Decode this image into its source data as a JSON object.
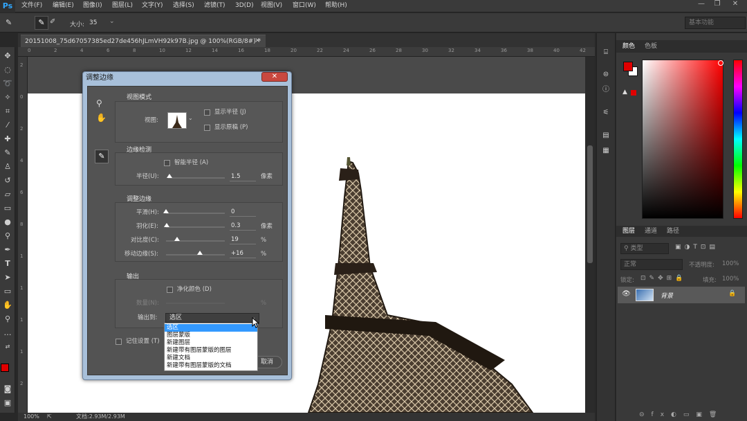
{
  "app": {
    "logo": "Ps"
  },
  "menu": [
    "文件(F)",
    "编辑(E)",
    "图像(I)",
    "图层(L)",
    "文字(Y)",
    "选择(S)",
    "滤镜(T)",
    "3D(D)",
    "视图(V)",
    "窗口(W)",
    "帮助(H)"
  ],
  "window_controls": {
    "minimize": "—",
    "restore": "❐",
    "close": "✕"
  },
  "options_bar": {
    "size_label": "大小:",
    "size_value": "35",
    "workspace": "基本功能"
  },
  "document": {
    "tab_title": "20151008_75d67057385ed27de456hJLmVH92k97B.jpg @ 100%(RGB/8#) *",
    "tab_close": "×",
    "zoom": "100%",
    "doc_info": "文档:2.93M/2.93M",
    "ruler_top_ticks": [
      "0",
      "2",
      "4",
      "6",
      "8",
      "10",
      "12",
      "14",
      "16",
      "18",
      "20",
      "22",
      "24",
      "26",
      "28",
      "30",
      "32",
      "34",
      "36",
      "38",
      "40",
      "42"
    ],
    "ruler_left_ticks": [
      "2",
      "0",
      "2",
      "4",
      "6",
      "8",
      "1",
      "1",
      "1",
      "1",
      "2"
    ]
  },
  "color_panel": {
    "tabs": [
      "颜色",
      "色板"
    ],
    "foreground": "#e00000",
    "background": "#ffffff"
  },
  "layers_panel": {
    "tabs": [
      "图层",
      "通道",
      "路径"
    ],
    "filter_placeholder": "类型",
    "blend_mode": "正常",
    "opacity_label": "不透明度:",
    "opacity_value": "100%",
    "lock_label": "锁定:",
    "fill_label": "填充:",
    "fill_value": "100%",
    "layer_name": "背景"
  },
  "dialog": {
    "title": "调整边缘",
    "close": "✕",
    "view_mode": {
      "title": "视图模式",
      "view_label": "视图:",
      "show_radius": "显示半径 (J)",
      "show_original": "显示原稿 (P)"
    },
    "edge_detection": {
      "title": "边缘检测",
      "smart_radius": "智能半径 (A)",
      "radius_label": "半径(U):",
      "radius_value": "1.5",
      "radius_unit": "像素",
      "radius_level": 0.02
    },
    "adjust_edge": {
      "title": "调整边缘",
      "rows": [
        {
          "label": "平滑(H):",
          "value": "0",
          "unit": "",
          "level": 0.0
        },
        {
          "label": "羽化(E):",
          "value": "0.3",
          "unit": "像素",
          "level": 0.01
        },
        {
          "label": "对比度(C):",
          "value": "19",
          "unit": "%",
          "level": 0.19
        },
        {
          "label": "移动边缘(S):",
          "value": "+16",
          "unit": "%",
          "level": 0.58
        }
      ]
    },
    "output": {
      "title": "输出",
      "decontaminate": "净化颜色 (D)",
      "amount_label": "数量(N):",
      "amount_unit": "%",
      "output_to_label": "输出到:",
      "output_to_value": "选区",
      "options": [
        "选区",
        "图层蒙版",
        "新建图层",
        "新建带有图层蒙版的图层",
        "新建文档",
        "新建带有图层蒙版的文档"
      ],
      "selected_index": 0
    },
    "remember": "记住设置 (T)",
    "cancel": "取消"
  }
}
